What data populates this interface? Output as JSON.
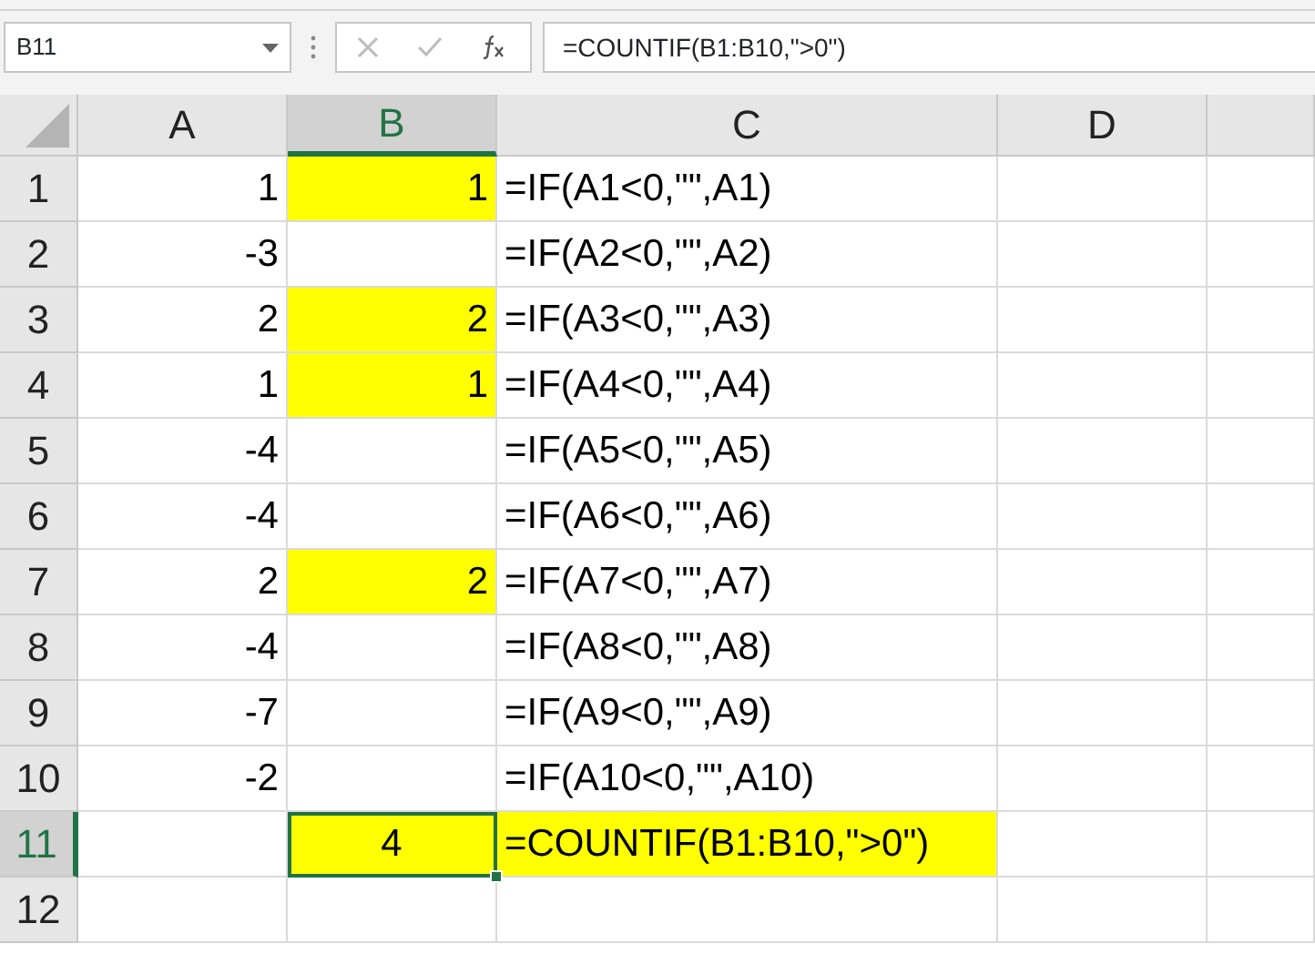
{
  "name_box": {
    "value": "B11"
  },
  "formula_bar": {
    "value": "=COUNTIF(B1:B10,\">0\")"
  },
  "columns": [
    {
      "label": "A",
      "selected": false
    },
    {
      "label": "B",
      "selected": true
    },
    {
      "label": "C",
      "selected": false
    },
    {
      "label": "D",
      "selected": false
    },
    {
      "selected": false
    }
  ],
  "rows": [
    {
      "label": "1",
      "selected": false,
      "cells": [
        {
          "value": "1",
          "kind": "number",
          "highlighted": false,
          "selected": false
        },
        {
          "value": "1",
          "kind": "number",
          "highlighted": true,
          "selected": false
        },
        {
          "value": "=IF(A1<0,\"\",A1)",
          "kind": "formula",
          "highlighted": false,
          "selected": false
        }
      ]
    },
    {
      "label": "2",
      "selected": false,
      "cells": [
        {
          "value": "-3",
          "kind": "number",
          "highlighted": false,
          "selected": false
        },
        {
          "kind": "number",
          "highlighted": false,
          "selected": false
        },
        {
          "value": "=IF(A2<0,\"\",A2)",
          "kind": "formula",
          "highlighted": false,
          "selected": false
        }
      ]
    },
    {
      "label": "3",
      "selected": false,
      "cells": [
        {
          "value": "2",
          "kind": "number",
          "highlighted": false,
          "selected": false
        },
        {
          "value": "2",
          "kind": "number",
          "highlighted": true,
          "selected": false
        },
        {
          "value": "=IF(A3<0,\"\",A3)",
          "kind": "formula",
          "highlighted": false,
          "selected": false
        }
      ]
    },
    {
      "label": "4",
      "selected": false,
      "cells": [
        {
          "value": "1",
          "kind": "number",
          "highlighted": false,
          "selected": false
        },
        {
          "value": "1",
          "kind": "number",
          "highlighted": true,
          "selected": false
        },
        {
          "value": "=IF(A4<0,\"\",A4)",
          "kind": "formula",
          "highlighted": false,
          "selected": false
        }
      ]
    },
    {
      "label": "5",
      "selected": false,
      "cells": [
        {
          "value": "-4",
          "kind": "number",
          "highlighted": false,
          "selected": false
        },
        {
          "kind": "number",
          "highlighted": false,
          "selected": false
        },
        {
          "value": "=IF(A5<0,\"\",A5)",
          "kind": "formula",
          "highlighted": false,
          "selected": false
        }
      ]
    },
    {
      "label": "6",
      "selected": false,
      "cells": [
        {
          "value": "-4",
          "kind": "number",
          "highlighted": false,
          "selected": false
        },
        {
          "kind": "number",
          "highlighted": false,
          "selected": false
        },
        {
          "value": "=IF(A6<0,\"\",A6)",
          "kind": "formula",
          "highlighted": false,
          "selected": false
        }
      ]
    },
    {
      "label": "7",
      "selected": false,
      "cells": [
        {
          "value": "2",
          "kind": "number",
          "highlighted": false,
          "selected": false
        },
        {
          "value": "2",
          "kind": "number",
          "highlighted": true,
          "selected": false
        },
        {
          "value": "=IF(A7<0,\"\",A7)",
          "kind": "formula",
          "highlighted": false,
          "selected": false
        }
      ]
    },
    {
      "label": "8",
      "selected": false,
      "cells": [
        {
          "value": "-4",
          "kind": "number",
          "highlighted": false,
          "selected": false
        },
        {
          "kind": "number",
          "highlighted": false,
          "selected": false
        },
        {
          "value": "=IF(A8<0,\"\",A8)",
          "kind": "formula",
          "highlighted": false,
          "selected": false
        }
      ]
    },
    {
      "label": "9",
      "selected": false,
      "cells": [
        {
          "value": "-7",
          "kind": "number",
          "highlighted": false,
          "selected": false
        },
        {
          "kind": "number",
          "highlighted": false,
          "selected": false
        },
        {
          "value": "=IF(A9<0,\"\",A9)",
          "kind": "formula",
          "highlighted": false,
          "selected": false
        }
      ]
    },
    {
      "label": "10",
      "selected": false,
      "cells": [
        {
          "value": "-2",
          "kind": "number",
          "highlighted": false,
          "selected": false
        },
        {
          "kind": "number",
          "highlighted": false,
          "selected": false
        },
        {
          "value": "=IF(A10<0,\"\",A10)",
          "kind": "formula",
          "highlighted": false,
          "selected": false
        }
      ]
    },
    {
      "label": "11",
      "selected": true,
      "cells": [
        {
          "kind": "number",
          "highlighted": false,
          "selected": false
        },
        {
          "value": "4",
          "kind": "centered",
          "highlighted": true,
          "selected": true
        },
        {
          "value": "=COUNTIF(B1:B10,\">0\")",
          "kind": "formula",
          "highlighted": true,
          "selected": false
        }
      ]
    },
    {
      "label": "12",
      "selected": false,
      "cells": []
    }
  ]
}
